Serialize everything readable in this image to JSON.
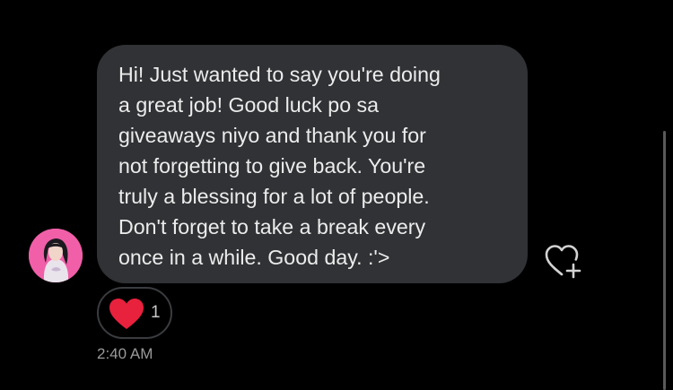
{
  "message": {
    "lines": [
      "Hi! Just wanted to say you're doing",
      "a great job! Good luck po sa",
      "giveaways niyo and thank you for",
      "not forgetting to give back. You're",
      "truly a blessing for a lot of people.",
      "Don't forget to take a break every",
      "once in a while. Good day. :'>"
    ],
    "timestamp": "2:40 AM"
  },
  "reaction": {
    "emoji_icon": "red-heart-icon",
    "count": "1"
  },
  "like_button_icon": "heart-plus-icon",
  "colors": {
    "background": "#000000",
    "bubble": "#303235",
    "message_text": "#ececec",
    "reaction_heart": "#e8213d",
    "avatar_bg": "#f05fa8",
    "timestamp_text": "#9a9a9a"
  }
}
